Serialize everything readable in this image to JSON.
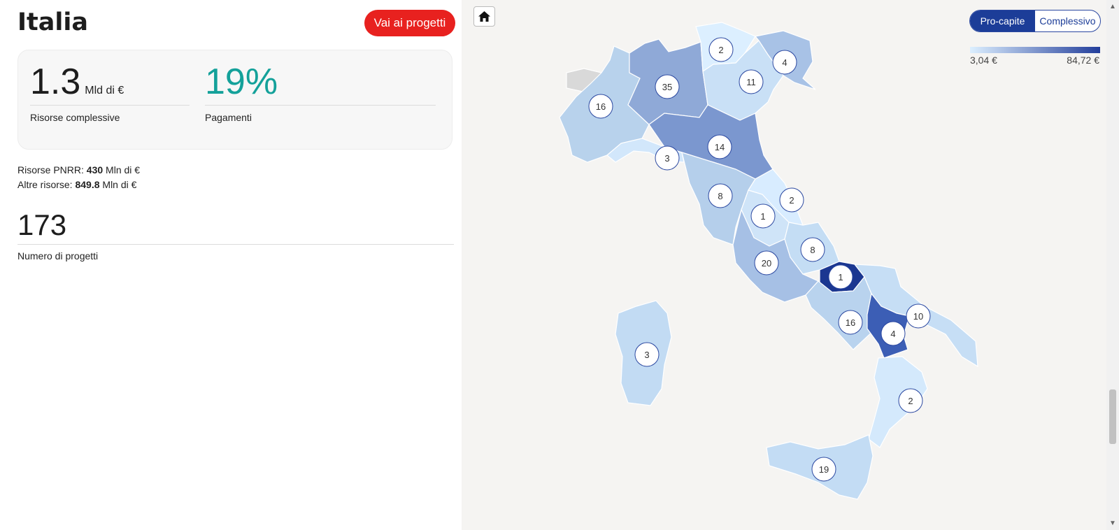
{
  "header": {
    "title": "Italia",
    "cta_label": "Vai ai progetti"
  },
  "summary": {
    "total_value": "1.3",
    "total_unit": "Mld di  €",
    "total_label": "Risorse complessive",
    "payments_value": "19%",
    "payments_label": "Pagamenti"
  },
  "funding": {
    "pnrr_label": "Risorse PNRR: ",
    "pnrr_value": "430",
    "pnrr_unit": " Mln di €",
    "other_label": "Altre risorse: ",
    "other_value": "849.8",
    "other_unit": " Mln di €"
  },
  "projects": {
    "count": "173",
    "label": "Numero di progetti"
  },
  "map": {
    "toggle": {
      "per_capita": "Pro-capite",
      "total": "Complessivo",
      "active": "per_capita"
    },
    "legend": {
      "min": "3,04 €",
      "max": "84,72 €",
      "color_min": "#dcefff",
      "color_max": "#233e9b"
    },
    "home_icon": "home-icon",
    "regions": [
      {
        "name": "Valle d'Aosta",
        "projects": null,
        "color": "#d9d9d9"
      },
      {
        "name": "Piemonte",
        "projects": 16,
        "color": "#b8d2ec"
      },
      {
        "name": "Lombardia",
        "projects": 35,
        "color": "#8fa9d7"
      },
      {
        "name": "Trentino-Alto Adige",
        "projects": 2,
        "color": "#dcefff"
      },
      {
        "name": "Veneto",
        "projects": 11,
        "color": "#c9e0f6"
      },
      {
        "name": "Friuli-Venezia Giulia",
        "projects": 4,
        "color": "#a8c2e6"
      },
      {
        "name": "Liguria",
        "projects": 3,
        "color": "#d2e7fb"
      },
      {
        "name": "Emilia-Romagna",
        "projects": 14,
        "color": "#7b97cf"
      },
      {
        "name": "Toscana",
        "projects": 8,
        "color": "#b5cfeb"
      },
      {
        "name": "Marche",
        "projects": 2,
        "color": "#d8ecff"
      },
      {
        "name": "Umbria",
        "projects": 1,
        "color": "#cfe4f8"
      },
      {
        "name": "Lazio",
        "projects": 20,
        "color": "#a6c0e5"
      },
      {
        "name": "Abruzzo",
        "projects": 8,
        "color": "#c4ddf4"
      },
      {
        "name": "Molise",
        "projects": 1,
        "color": "#1b3791"
      },
      {
        "name": "Campania",
        "projects": 16,
        "color": "#b9d3ee"
      },
      {
        "name": "Puglia",
        "projects": 10,
        "color": "#c6def5"
      },
      {
        "name": "Basilicata",
        "projects": 4,
        "color": "#3c5eb5"
      },
      {
        "name": "Calabria",
        "projects": 2,
        "color": "#d4e9fc"
      },
      {
        "name": "Sicilia",
        "projects": 19,
        "color": "#c3dcf4"
      },
      {
        "name": "Sardegna",
        "projects": 3,
        "color": "#c2dbf3"
      }
    ]
  }
}
